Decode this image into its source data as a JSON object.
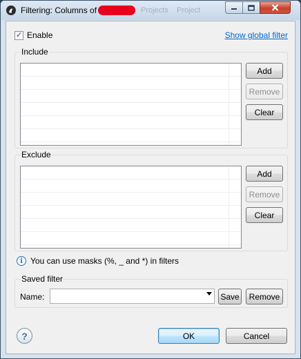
{
  "window": {
    "title": "Filtering: Columns of",
    "background_tabs": [
      "Projects",
      "Project"
    ],
    "controls": {
      "minimize": "minimize-icon",
      "maximize": "maximize-icon",
      "close": "close-icon"
    }
  },
  "enable": {
    "label": "Enable",
    "checked": true,
    "check_glyph": "✓"
  },
  "show_global_filter": "Show global filter",
  "include": {
    "label": "Include",
    "rows": [],
    "buttons": {
      "add": "Add",
      "remove": "Remove",
      "clear": "Clear"
    }
  },
  "exclude": {
    "label": "Exclude",
    "rows": [],
    "buttons": {
      "add": "Add",
      "remove": "Remove",
      "clear": "Clear"
    }
  },
  "hint": {
    "icon": "info-icon",
    "glyph": "i",
    "text": "You can use masks (%, _ and *) in filters"
  },
  "saved_filter": {
    "label": "Saved filter",
    "name_label": "Name:",
    "name_value": "",
    "save": "Save",
    "remove": "Remove"
  },
  "footer": {
    "help_glyph": "?",
    "ok": "OK",
    "cancel": "Cancel"
  },
  "colors": {
    "accent_link": "#0066cc",
    "redaction": "#e8001c",
    "dialog_bg": "#f0f0f0",
    "frame": "#d6e2ee"
  }
}
